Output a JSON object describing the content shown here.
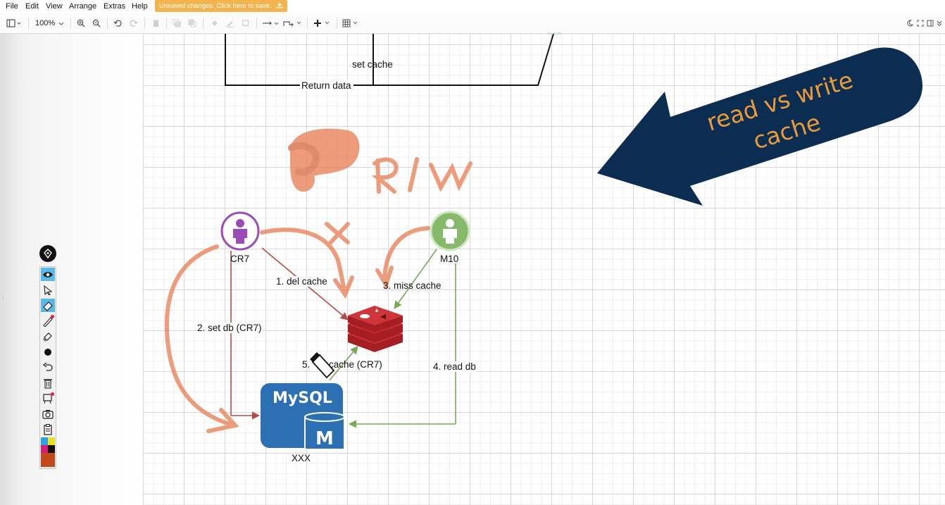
{
  "menu": {
    "items": [
      "File",
      "Edit",
      "View",
      "Arrange",
      "Extras",
      "Help"
    ],
    "unsaved_banner": "Unsaved changes. Click here to save."
  },
  "toolbar": {
    "zoom": "100%"
  },
  "diagram": {
    "labels": {
      "set_cache": "set cache",
      "return_data": "Return data",
      "cr7": "CR7",
      "m10": "M10",
      "del_cache": "1. del cache",
      "set_db": "2. set db (CR7)",
      "miss_cache": "3. miss cache",
      "read_db": "4. read db",
      "step5_num": "5.",
      "step5_text": "cache (CR7)",
      "xxx": "XXX",
      "partial_top": "XXX"
    },
    "mysql_logo": {
      "word": "MySQL",
      "letter": "M"
    }
  },
  "banner": {
    "line1": "read vs write",
    "line2": "cache"
  },
  "annotation": {
    "text": "R/W"
  },
  "palette": {
    "swatches": [
      "#2aa3e0",
      "#e8e020",
      "#d81e7a",
      "#111111",
      "#c24a1a"
    ]
  },
  "colors": {
    "banner_navy": "#0c2d52",
    "banner_text": "#e99a3a",
    "brush_orange": "#e8835b",
    "redis_red": "#c8262d",
    "mysql_blue": "#2c6fb3",
    "cr7_purple": "#9c4ab8",
    "m10_green": "#86b96a",
    "arrow_red": "#b64a4a",
    "arrow_green": "#7aa85a"
  }
}
